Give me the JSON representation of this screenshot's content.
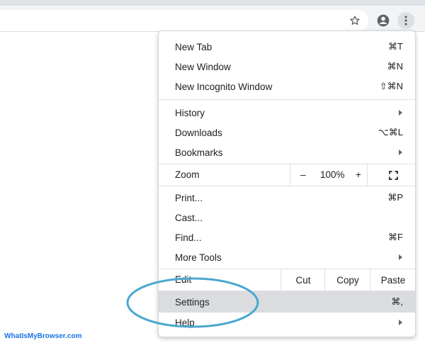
{
  "toolbar": {
    "icons": [
      "star-icon",
      "profile-icon",
      "kebab-menu-icon"
    ]
  },
  "menu": {
    "new_tab": {
      "label": "New Tab",
      "shortcut": "⌘T"
    },
    "new_window": {
      "label": "New Window",
      "shortcut": "⌘N"
    },
    "new_incognito": {
      "label": "New Incognito Window",
      "shortcut": "⇧⌘N"
    },
    "history": {
      "label": "History"
    },
    "downloads": {
      "label": "Downloads",
      "shortcut": "⌥⌘L"
    },
    "bookmarks": {
      "label": "Bookmarks"
    },
    "zoom": {
      "label": "Zoom",
      "minus": "–",
      "value": "100%",
      "plus": "+"
    },
    "print": {
      "label": "Print...",
      "shortcut": "⌘P"
    },
    "cast": {
      "label": "Cast..."
    },
    "find": {
      "label": "Find...",
      "shortcut": "⌘F"
    },
    "more_tools": {
      "label": "More Tools"
    },
    "edit": {
      "label": "Edit",
      "cut": "Cut",
      "copy": "Copy",
      "paste": "Paste"
    },
    "settings": {
      "label": "Settings",
      "shortcut": "⌘,"
    },
    "help": {
      "label": "Help"
    }
  },
  "highlight_color": "#4aa8cf",
  "watermark": "WhatIsMyBrowser.com"
}
